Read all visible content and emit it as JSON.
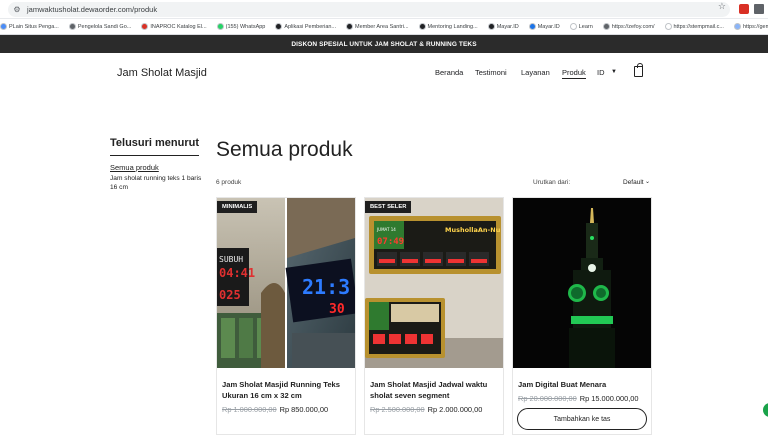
{
  "browser": {
    "url": "jamwaktusholat.dewaorder.com/produk",
    "bookmarks": [
      {
        "label": "PLain Situs Penga...",
        "color": "#4a8cf7"
      },
      {
        "label": "Pengelola Sandi Go...",
        "color": "#5f6368"
      },
      {
        "label": "INAPROC Katalog El...",
        "color": "#d93025"
      },
      {
        "label": "(155) WhatsApp",
        "color": "#25d366"
      },
      {
        "label": "Aplikasi Pemberian...",
        "color": "#202124"
      },
      {
        "label": "Member Area Santri...",
        "color": "#202124"
      },
      {
        "label": "Mentoring Landing...",
        "color": "#202124"
      },
      {
        "label": "Mayar.ID",
        "color": "#202124"
      },
      {
        "label": "Mayar.ID",
        "color": "#1a73e8"
      },
      {
        "label": "Learn",
        "color": "#ffffff"
      },
      {
        "label": "https://zefoy.com/",
        "color": "#5f6368"
      },
      {
        "label": "https://stempmail.c...",
        "color": "#ffffff"
      },
      {
        "label": "https://gemini.goog...",
        "color": "#8ab4f8"
      }
    ]
  },
  "site": {
    "promo": "DISKON SPESIAL UNTUK JAM SHOLAT & RUNNING TEKS",
    "logo": "Jam Sholat Masjid",
    "nav": [
      "Beranda",
      "Testimoni",
      "Layanan",
      "Produk"
    ],
    "lang": "ID",
    "sidebar": {
      "title": "Telusuri menurut",
      "link": "Semua produk",
      "item": "Jam sholat running teks 1 baris 16 cm"
    },
    "main": {
      "title": "Semua produk",
      "count": "6 produk",
      "sort_label": "Urutkan dari:",
      "sort_value": "Default"
    },
    "products": [
      {
        "badge": "MINIMALIS",
        "name_line1": "Jam Sholat Masjid Running Teks",
        "name_line2": "Ukuran 16 cm x 32 cm",
        "old_price": "Rp 1.000.000,00",
        "price": "Rp 850.000,00"
      },
      {
        "badge": "BEST SELER",
        "name_line1": "Jam Sholat Masjid Jadwal waktu",
        "name_line2": "sholat seven segment",
        "old_price": "Rp 2.500.000,00",
        "price": "Rp 2.000.000,00"
      },
      {
        "badge": "",
        "name_line1": "Jam Digital Buat Menara",
        "name_line2": "",
        "old_price": "Rp 20.000.000,00",
        "price": "Rp 15.000.000,00",
        "button": "Tambahkan ke tas"
      }
    ],
    "img_text": {
      "subuh": "SUBUH",
      "subuh_time": "04:41",
      "p1_num": "025",
      "p1b_time": "21:3",
      "p1b_sub": "30",
      "p2_brand": "MushollaAn-Nu",
      "p2_time": "07:49",
      "p2_date": "JUMAT 14"
    }
  }
}
